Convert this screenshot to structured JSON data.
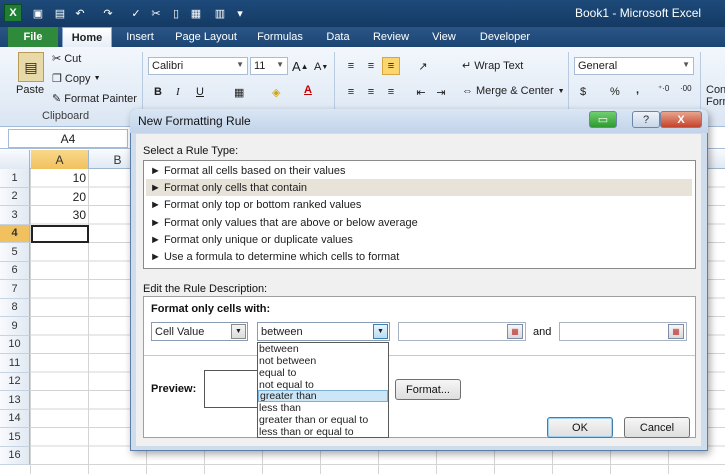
{
  "window": {
    "title": "Book1 - Microsoft Excel"
  },
  "quick_access": [
    "save-icon",
    "undo-icon",
    "redo-icon",
    "spell-icon",
    "cut-icon",
    "doc-icon",
    "paste-icon"
  ],
  "tabs": {
    "file": "File",
    "items": [
      "Home",
      "Insert",
      "Page Layout",
      "Formulas",
      "Data",
      "Review",
      "View",
      "Developer"
    ],
    "active": "Home"
  },
  "ribbon": {
    "clipboard": {
      "paste": "Paste",
      "cut": "Cut",
      "copy": "Copy",
      "format_painter": "Format Painter",
      "group_label": "Clipboard"
    },
    "font": {
      "name": "Calibri",
      "size": "11",
      "grow": "A",
      "shrink": "A",
      "bold": "B",
      "italic": "I",
      "underline": "U"
    },
    "alignment": {
      "wrap_text": "Wrap Text",
      "merge_center": "Merge & Center"
    },
    "number": {
      "format": "General",
      "currency": "$",
      "percent": "%",
      "comma": ","
    },
    "styles": {
      "conditional_line1": "Con",
      "conditional_line2": "Form"
    }
  },
  "formula_bar": {
    "name_box": "A4"
  },
  "sheet": {
    "columns": [
      "A",
      "B"
    ],
    "selected_column": "A",
    "rows": [
      "1",
      "2",
      "3",
      "4",
      "5",
      "6",
      "7",
      "8",
      "9",
      "10",
      "11",
      "12",
      "13",
      "14",
      "15",
      "16"
    ],
    "selected_row": "4",
    "cells_a": [
      "10",
      "20",
      "30"
    ]
  },
  "dialog": {
    "title": "New Formatting Rule",
    "select_rule_label": "Select a Rule Type:",
    "rule_types": [
      "► Format all cells based on their values",
      "► Format only cells that contain",
      "► Format only top or bottom ranked values",
      "► Format only values that are above or below average",
      "► Format only unique or duplicate values",
      "► Use a formula to determine which cells to format"
    ],
    "selected_rule_index": 1,
    "edit_desc_label": "Edit the Rule Description:",
    "format_only_label": "Format only cells with:",
    "condition_type": "Cell Value",
    "operator": "between",
    "and_label": "and",
    "operator_options": [
      "between",
      "not between",
      "equal to",
      "not equal to",
      "greater than",
      "less than",
      "greater than or equal to",
      "less than or equal to"
    ],
    "highlighted_option_index": 4,
    "preview_label": "Preview:",
    "format_button": "Format...",
    "ok_button": "OK",
    "cancel_button": "Cancel",
    "help_glyph": "?",
    "close_glyph": "X"
  },
  "colors": {
    "title_bar": "#1d4a7a",
    "file_tab": "#2f8a3c",
    "selection_header": "#f1c15f",
    "dropdown_highlight": "#cde6f7"
  }
}
